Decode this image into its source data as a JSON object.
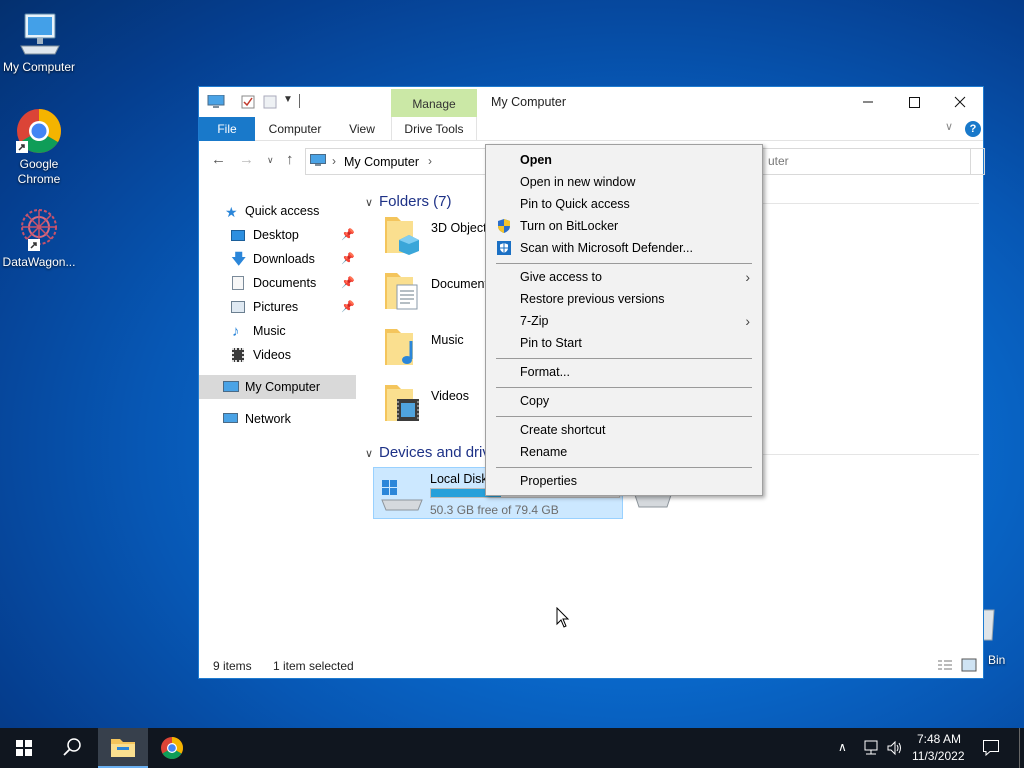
{
  "desktop": {
    "icons": [
      {
        "label": "My Computer"
      },
      {
        "label": "Google Chrome"
      },
      {
        "label": "DataWagon..."
      },
      {
        "label": "Bin"
      }
    ]
  },
  "window": {
    "title": "My Computer",
    "manage_label": "Manage",
    "tabs": {
      "file": "File",
      "computer": "Computer",
      "view": "View",
      "drive_tools": "Drive Tools"
    },
    "address": {
      "location": "My Computer",
      "search_placeholder": "uter"
    },
    "sidebar": {
      "quick_access": "Quick access",
      "items": [
        {
          "label": "Desktop",
          "pinned": true
        },
        {
          "label": "Downloads",
          "pinned": true
        },
        {
          "label": "Documents",
          "pinned": true
        },
        {
          "label": "Pictures",
          "pinned": true
        },
        {
          "label": "Music",
          "pinned": false
        },
        {
          "label": "Videos",
          "pinned": false
        }
      ],
      "my_computer": "My Computer",
      "network": "Network"
    },
    "content": {
      "folders_header": "Folders (7)",
      "folders": [
        "3D Objects",
        "Document",
        "Music",
        "Videos"
      ],
      "devices_header": "Devices and drivi",
      "drive": {
        "name": "Local Disk",
        "free_text": "50.3 GB free of 79.4 GB",
        "used_fraction": 0.37
      }
    },
    "status": {
      "items": "9 items",
      "selected": "1 item selected"
    }
  },
  "context_menu": {
    "items": [
      {
        "label": "Open",
        "bold": true
      },
      {
        "label": "Open in new window"
      },
      {
        "label": "Pin to Quick access"
      },
      {
        "label": "Turn on BitLocker",
        "icon": "shield-icon"
      },
      {
        "label": "Scan with Microsoft Defender...",
        "icon": "defender-icon"
      },
      {
        "label": "Give access to",
        "submenu": true
      },
      {
        "label": "Restore previous versions"
      },
      {
        "label": "7-Zip",
        "submenu": true
      },
      {
        "label": "Pin to Start"
      },
      {
        "label": "Format..."
      },
      {
        "label": "Copy"
      },
      {
        "label": "Create shortcut"
      },
      {
        "label": "Rename"
      },
      {
        "label": "Properties"
      }
    ]
  },
  "taskbar": {
    "clock_time": "7:48 AM",
    "clock_date": "11/3/2022"
  },
  "colors": {
    "accent": "#0063b1",
    "manage_tab": "#cbe8a6",
    "selection": "#cce8ff"
  }
}
